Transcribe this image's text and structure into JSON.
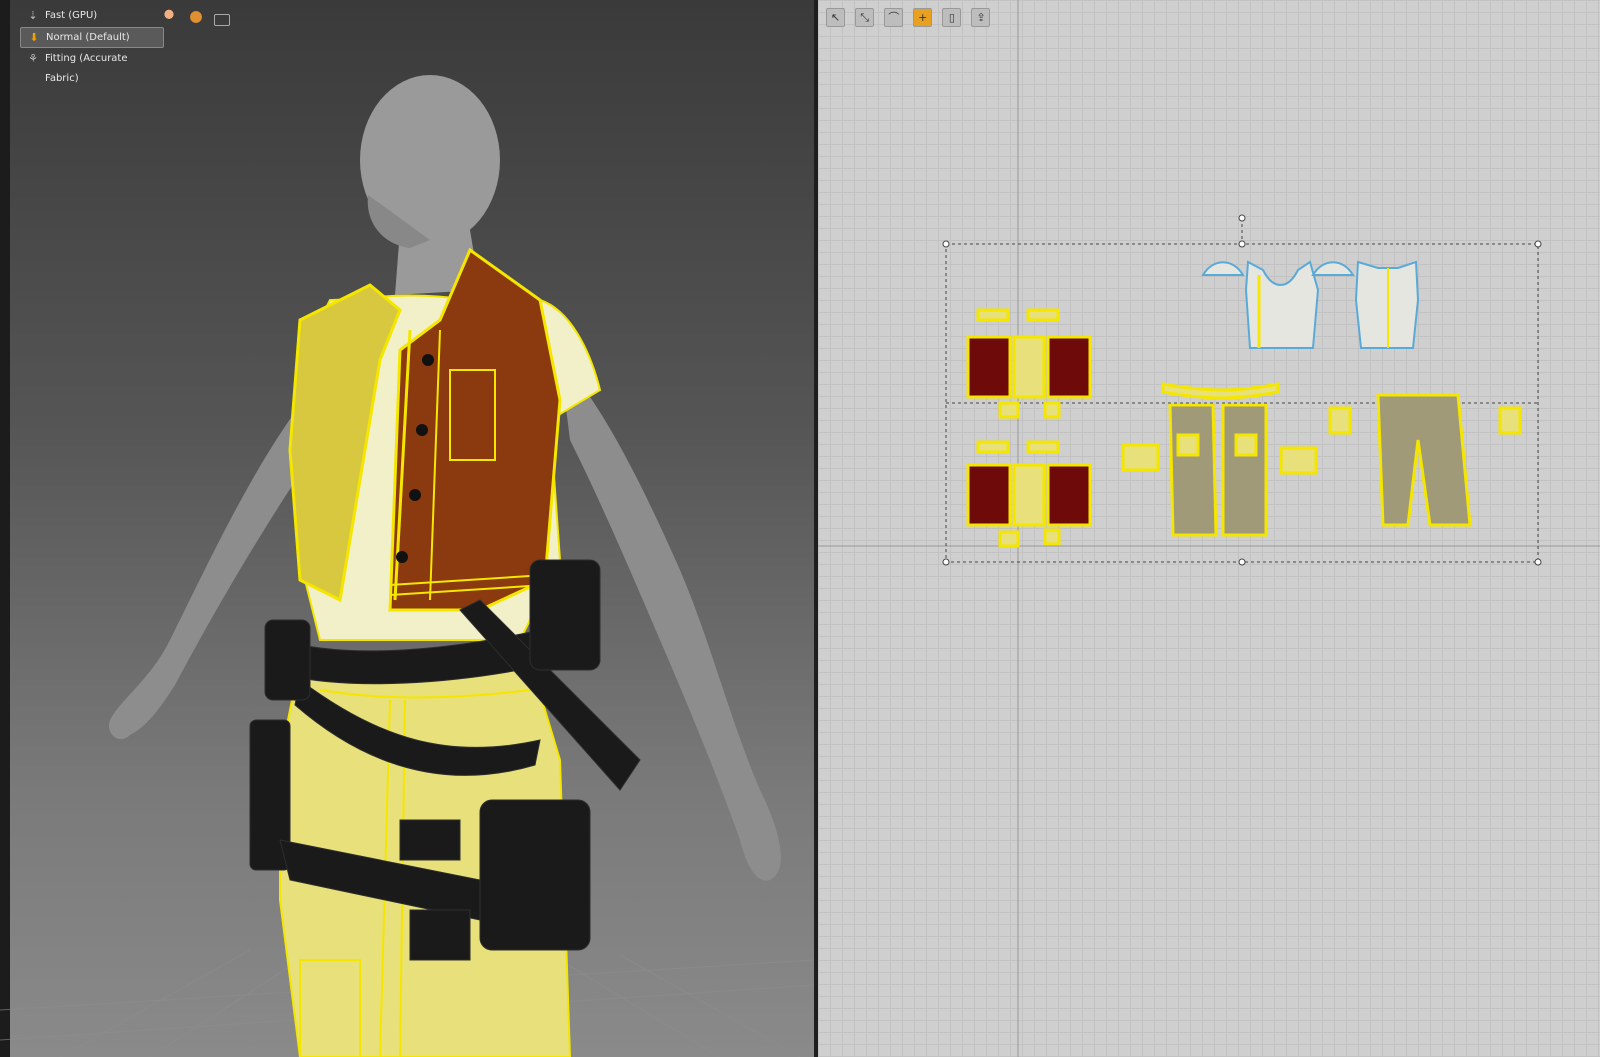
{
  "simulation_menu": {
    "items": [
      {
        "label": "Fast (GPU)",
        "icon": "fast-gpu-icon",
        "selected": false
      },
      {
        "label": "Normal (Default)",
        "icon": "normal-mode-icon",
        "selected": true
      },
      {
        "label": "Fitting (Accurate Fabric)",
        "icon": "fitting-mode-icon",
        "selected": false
      }
    ]
  },
  "viewport_toolbar": [
    "avatar-icon",
    "fabric-sphere-icon",
    "export-icon"
  ],
  "pattern_toolbar": [
    "edit-pattern-icon",
    "transform-pattern-icon",
    "edit-curve-icon",
    "add-point-icon",
    "fold-arrange-icon",
    "sewing-icon"
  ],
  "colors": {
    "selection_yellow": "#f5e600",
    "vest_leather": "#8b3a0f",
    "shirt": "#f2f0c8",
    "pants": "#e8e07a",
    "gear": "#1a1a1a",
    "pattern_dark_red": "#6e0a0a",
    "pattern_olive": "#a09a78",
    "pattern_light": "#e6e6e0"
  }
}
